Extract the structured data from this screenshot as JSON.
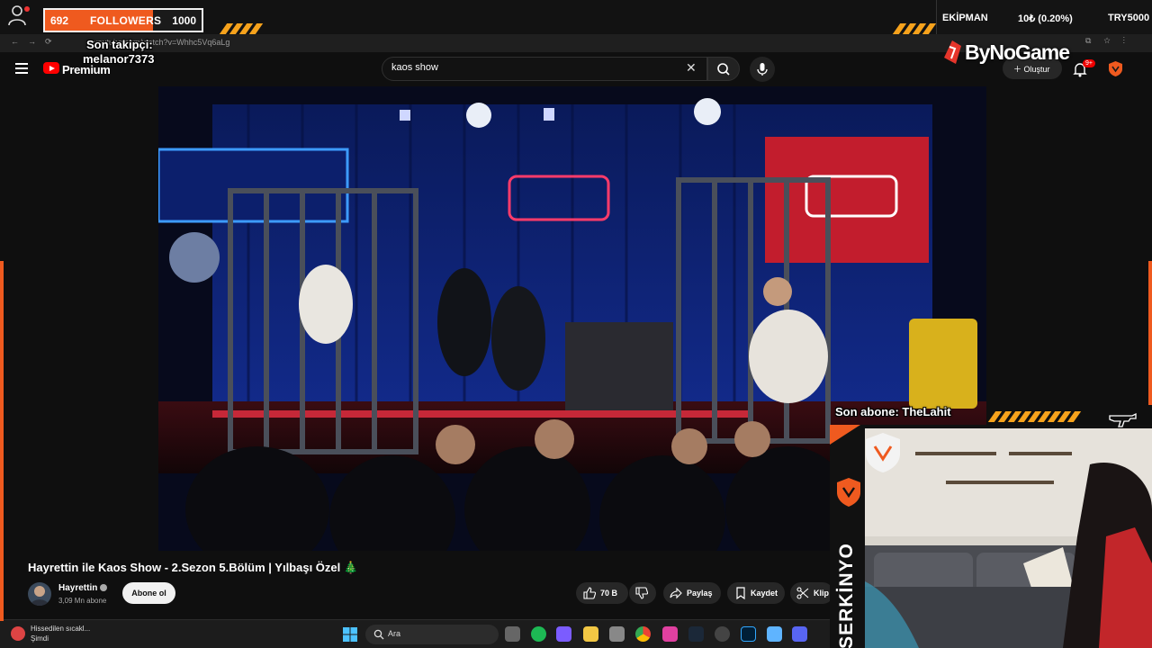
{
  "overlay": {
    "followers_current": "692",
    "followers_label": "FOLLOWERS",
    "followers_goal": "1000",
    "followers_progress": 0.692,
    "stats": {
      "ekipman": "EKİPMAN",
      "ekipman_value": "10₺ (0.20%)",
      "goal": "TRY5000"
    },
    "last_follower_label": "Son takipçi:",
    "last_follower_name": "melanor7373",
    "sponsor": "ByNoGame",
    "last_sub": "Son abone: TheLahit",
    "streamer": "SERKİNYO",
    "accent": "#ef5a1f",
    "stripe_color": "#f6a21c"
  },
  "browser": {
    "url": "youtube.com/watch?v=Whhc5Vq6aLg"
  },
  "youtube": {
    "brand": "Premium",
    "search_value": "kaos show",
    "create_label": "Oluştur",
    "notifications": "9+"
  },
  "video": {
    "title": "Hayrettin ile Kaos Show - 2.Sezon 5.Bölüm | Yılbaşı Özel 🎄",
    "channel": "Hayrettin",
    "subscribers": "3,09 Mn abone",
    "subscribe_label": "Abone ol",
    "likes": "70 B",
    "share_label": "Paylaş",
    "save_label": "Kaydet",
    "clip_label": "Klip"
  },
  "taskbar": {
    "weather_title": "Hissedilen sıcakl...",
    "weather_sub": "Şimdi",
    "search_label": "Ara"
  }
}
